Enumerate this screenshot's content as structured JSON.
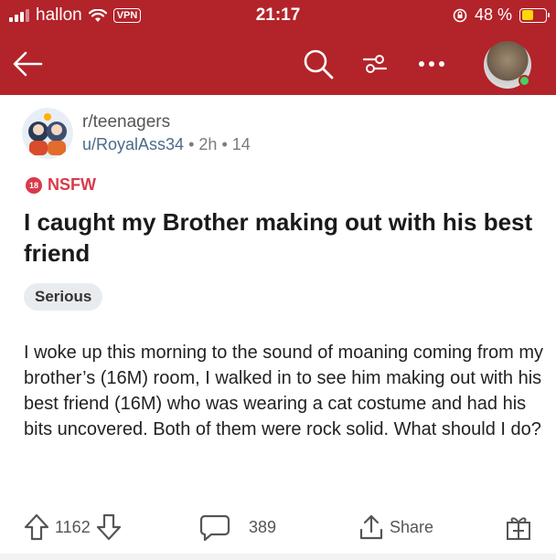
{
  "status_bar": {
    "carrier": "hallon",
    "vpn": "VPN",
    "time": "21:17",
    "battery_pct": "48 %",
    "battery_level": 0.48
  },
  "nav": {
    "back_icon": "arrow-left-icon",
    "search_icon": "search-icon",
    "filter_icon": "sort-filter-icon",
    "more_icon": "more-dots-icon",
    "bar_color": "#b3232a"
  },
  "post": {
    "subreddit": "r/teenagers",
    "author": "u/RoyalAss34",
    "age": "2h",
    "extra": "14",
    "nsfw_label": "NSFW",
    "nsfw_icon_text": "18",
    "title": "I caught my Brother making out with his best friend",
    "flair": "Serious",
    "body": "I woke up this morning to the sound of moaning coming from my brother’s (16M) room, I walked in to see him making out with his best friend (16M) who was wearing a cat costume and had his bits uncovered. Both of them were rock solid. What should I do?"
  },
  "actions": {
    "upvotes": "1162",
    "comments": "389",
    "share": "Share"
  }
}
